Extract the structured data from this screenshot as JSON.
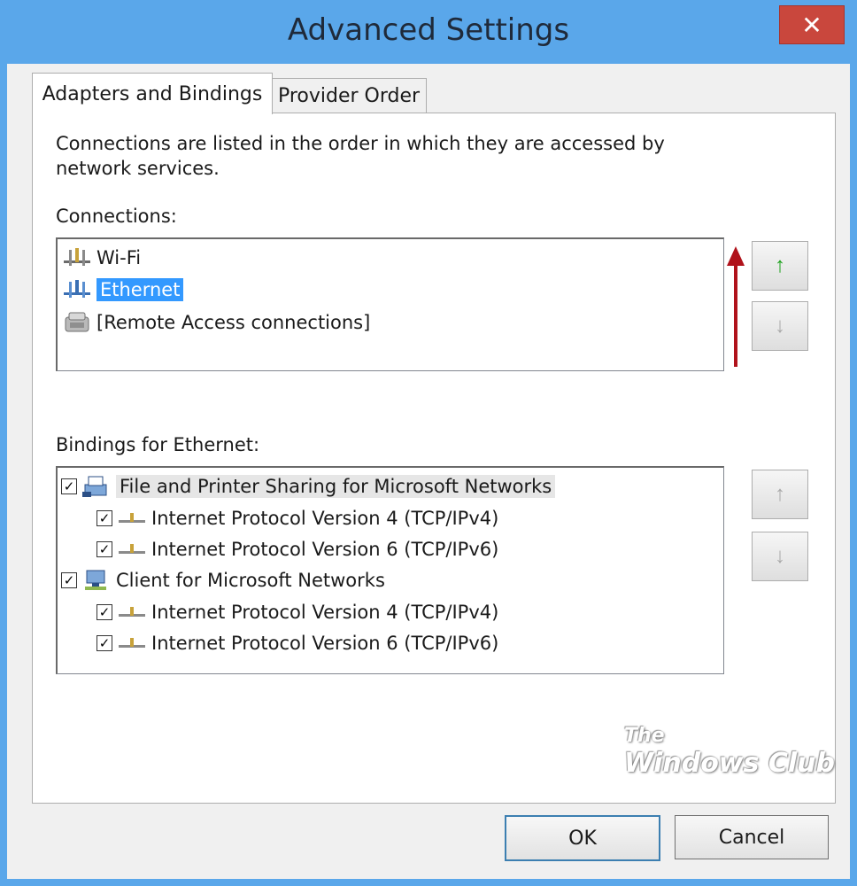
{
  "window": {
    "title": "Advanced Settings",
    "close_glyph": "✕"
  },
  "tabs": [
    {
      "label": "Adapters and Bindings",
      "active": true
    },
    {
      "label": "Provider Order",
      "active": false
    }
  ],
  "intro_text": "Connections are listed in the order in which they are accessed by network services.",
  "connections": {
    "label": "Connections:",
    "items": [
      {
        "label": "Wi-Fi",
        "icon": "network-adapter-icon",
        "selected": false
      },
      {
        "label": "Ethernet",
        "icon": "network-adapter-icon",
        "selected": true
      },
      {
        "label": "[Remote Access connections]",
        "icon": "remote-access-icon",
        "selected": false
      }
    ],
    "up_glyph": "↑",
    "down_glyph": "↓"
  },
  "bindings": {
    "label": "Bindings for Ethernet:",
    "items": [
      {
        "label": "File and Printer Sharing for Microsoft Networks",
        "checked": true,
        "level": 0,
        "icon": "file-printer-sharing-icon"
      },
      {
        "label": "Internet Protocol Version 4 (TCP/IPv4)",
        "checked": true,
        "level": 1,
        "icon": "protocol-icon"
      },
      {
        "label": "Internet Protocol Version 6 (TCP/IPv6)",
        "checked": true,
        "level": 1,
        "icon": "protocol-icon"
      },
      {
        "label": "Client for Microsoft Networks",
        "checked": true,
        "level": 0,
        "icon": "network-client-icon"
      },
      {
        "label": "Internet Protocol Version 4 (TCP/IPv4)",
        "checked": true,
        "level": 1,
        "icon": "protocol-icon"
      },
      {
        "label": "Internet Protocol Version 6 (TCP/IPv6)",
        "checked": true,
        "level": 1,
        "icon": "protocol-icon"
      }
    ],
    "up_glyph": "↑",
    "down_glyph": "↓"
  },
  "watermark": {
    "line1": "The",
    "line2": "Windows Club"
  },
  "buttons": {
    "ok": "OK",
    "cancel": "Cancel"
  },
  "colors": {
    "titlebar": "#5aa7ea",
    "close": "#c9473d",
    "selection": "#3399ff",
    "up_arrow_enabled": "#1aa11a",
    "annotation_arrow": "#b0121b"
  }
}
